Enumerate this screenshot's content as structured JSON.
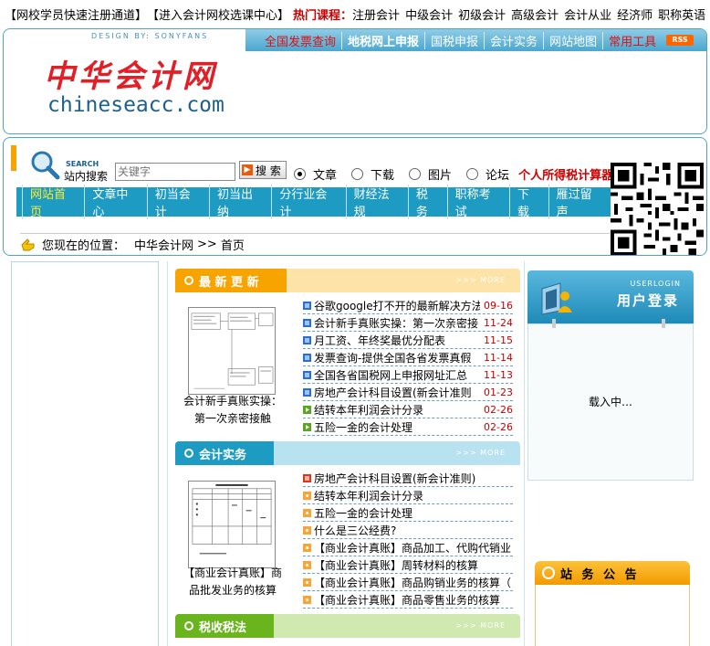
{
  "topbar": {
    "link1": "【网校学员快速注册通道】",
    "link2": "【进入会计网校选课中心】",
    "hot_label": "热门课程：",
    "courses": [
      "注册会计",
      "中级会计",
      "初级会计",
      "高级会计",
      "会计从业",
      "经济师",
      "职称英语"
    ]
  },
  "header": {
    "design_credit": "DESIGN BY: SONYFANS",
    "logo_cn": "中华会计网",
    "logo_en": "chineseacc.com",
    "nav": [
      "全国发票查询",
      "地税网上申报",
      "国税申报",
      "会计实务",
      "网站地图",
      "常用工具"
    ],
    "rss": "RSS"
  },
  "search": {
    "label_en": "SEARCH",
    "label_cn": "站内搜索",
    "placeholder": "关键字",
    "button": "搜 索",
    "options": [
      "文章",
      "下载",
      "图片",
      "论坛"
    ],
    "selected": "文章",
    "tax_calc": "个人所得税计算器"
  },
  "category_nav": {
    "items": [
      "网站首页",
      "文章中心",
      "初当会计",
      "初当出纳",
      "分行业会计",
      "财经法规",
      "税务",
      "职称考试",
      "下载",
      "雁过留声"
    ],
    "current": "网站首页"
  },
  "location": {
    "prefix": "您现在的位置：",
    "site": "中华会计网",
    "sep": ">>",
    "page": "首页"
  },
  "latest": {
    "title": "最 新 更 新",
    "more": ">>> MORE",
    "thumb_caption": "会计新手真账实操：第一次亲密接触",
    "items": [
      {
        "text": "谷歌google打不开的最新解决方法",
        "date": "09-16"
      },
      {
        "text": "会计新手真账实操：第一次亲密接",
        "date": "11-24"
      },
      {
        "text": "月工资、年终奖最优分配表",
        "date": "11-15"
      },
      {
        "text": "发票查询-提供全国各省发票真假",
        "date": "11-14"
      },
      {
        "text": "全国各省国税网上申报网址汇总",
        "date": "11-13"
      },
      {
        "text": "房地产会计科目设置(新会计准则",
        "date": "01-23"
      },
      {
        "text": "结转本年利润会计分录",
        "date": "02-26"
      },
      {
        "text": "五险一金的会计处理",
        "date": "02-26"
      }
    ]
  },
  "practice": {
    "title": "会计实务",
    "more": ">>> MORE",
    "thumb_caption": "【商业会计真账】商品批发业务的核算",
    "items": [
      "房地产会计科目设置(新会计准则)",
      "结转本年利润会计分录",
      "五险一金的会计处理",
      "什么是三公经费?",
      "【商业会计真账】商品加工、代购代销业",
      "【商业会计真账】周转材料的核算",
      "【商业会计真账】商品购销业务的核算（",
      "【商业会计真账】商品零售业务的核算"
    ]
  },
  "tax": {
    "title": "税收税法",
    "more": ">>> MORE"
  },
  "login": {
    "title_en": "USERLOGIN",
    "title_cn": "用户登录",
    "loading": "载入中…"
  },
  "notice": {
    "title": "站 务 公 告"
  },
  "colors": {
    "brand_blue": "#1e9bc2",
    "orange": "#f7a400",
    "green": "#6ab51e",
    "red": "#c00000"
  }
}
